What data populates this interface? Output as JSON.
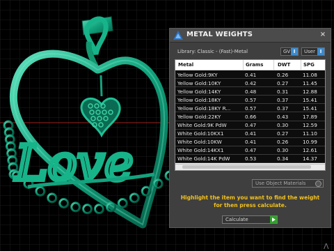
{
  "panel": {
    "title": "METAL WEIGHTS",
    "close_label": "×",
    "library_label": "Library: Classic - (Fast)-Metal",
    "dropdowns": [
      {
        "label": "GV",
        "arrow": "I"
      },
      {
        "label": "User",
        "arrow": "I"
      }
    ],
    "columns": [
      "Metal",
      "Grams",
      "DWT",
      "SPG"
    ],
    "rows": [
      {
        "metal": "Yellow Gold:9KY",
        "grams": "0.41",
        "dwt": "0.26",
        "spg": "11.08"
      },
      {
        "metal": "Yellow Gold:10KY",
        "grams": "0.42",
        "dwt": "0.27",
        "spg": "11.45"
      },
      {
        "metal": "Yellow Gold:14KY",
        "grams": "0.48",
        "dwt": "0.31",
        "spg": "12.88"
      },
      {
        "metal": "Yellow Gold:18KY",
        "grams": "0.57",
        "dwt": "0.37",
        "spg": "15.41"
      },
      {
        "metal": "Yellow Gold:18KY R...",
        "grams": "0.57",
        "dwt": "0.37",
        "spg": "15.41"
      },
      {
        "metal": "Yellow Gold:22KY",
        "grams": "0.66",
        "dwt": "0.43",
        "spg": "17.89"
      },
      {
        "metal": "White Gold:9K PdW",
        "grams": "0.47",
        "dwt": "0.30",
        "spg": "12.59"
      },
      {
        "metal": "White Gold:10KX1",
        "grams": "0.41",
        "dwt": "0.27",
        "spg": "11.10"
      },
      {
        "metal": "White Gold:10KW",
        "grams": "0.41",
        "dwt": "0.26",
        "spg": "10.99"
      },
      {
        "metal": "White Gold:14KX1",
        "grams": "0.47",
        "dwt": "0.30",
        "spg": "12.61"
      },
      {
        "metal": "White Gold:14K PdW",
        "grams": "0.53",
        "dwt": "0.34",
        "spg": "14.37"
      }
    ],
    "use_materials_label": "Use Object Materials",
    "hint_line1": "Highlight the item you want to find the weight",
    "hint_line2": "for then press calculate.",
    "calculate_label": "Calculate"
  },
  "viewport": {
    "pendant_text": "Love",
    "colors": {
      "metal": "#0e8f6e",
      "metal_light": "#3fd0a4",
      "grid": "#1c1c1c",
      "axis_red": "#b0201b"
    }
  },
  "corner_marker": "Λ"
}
